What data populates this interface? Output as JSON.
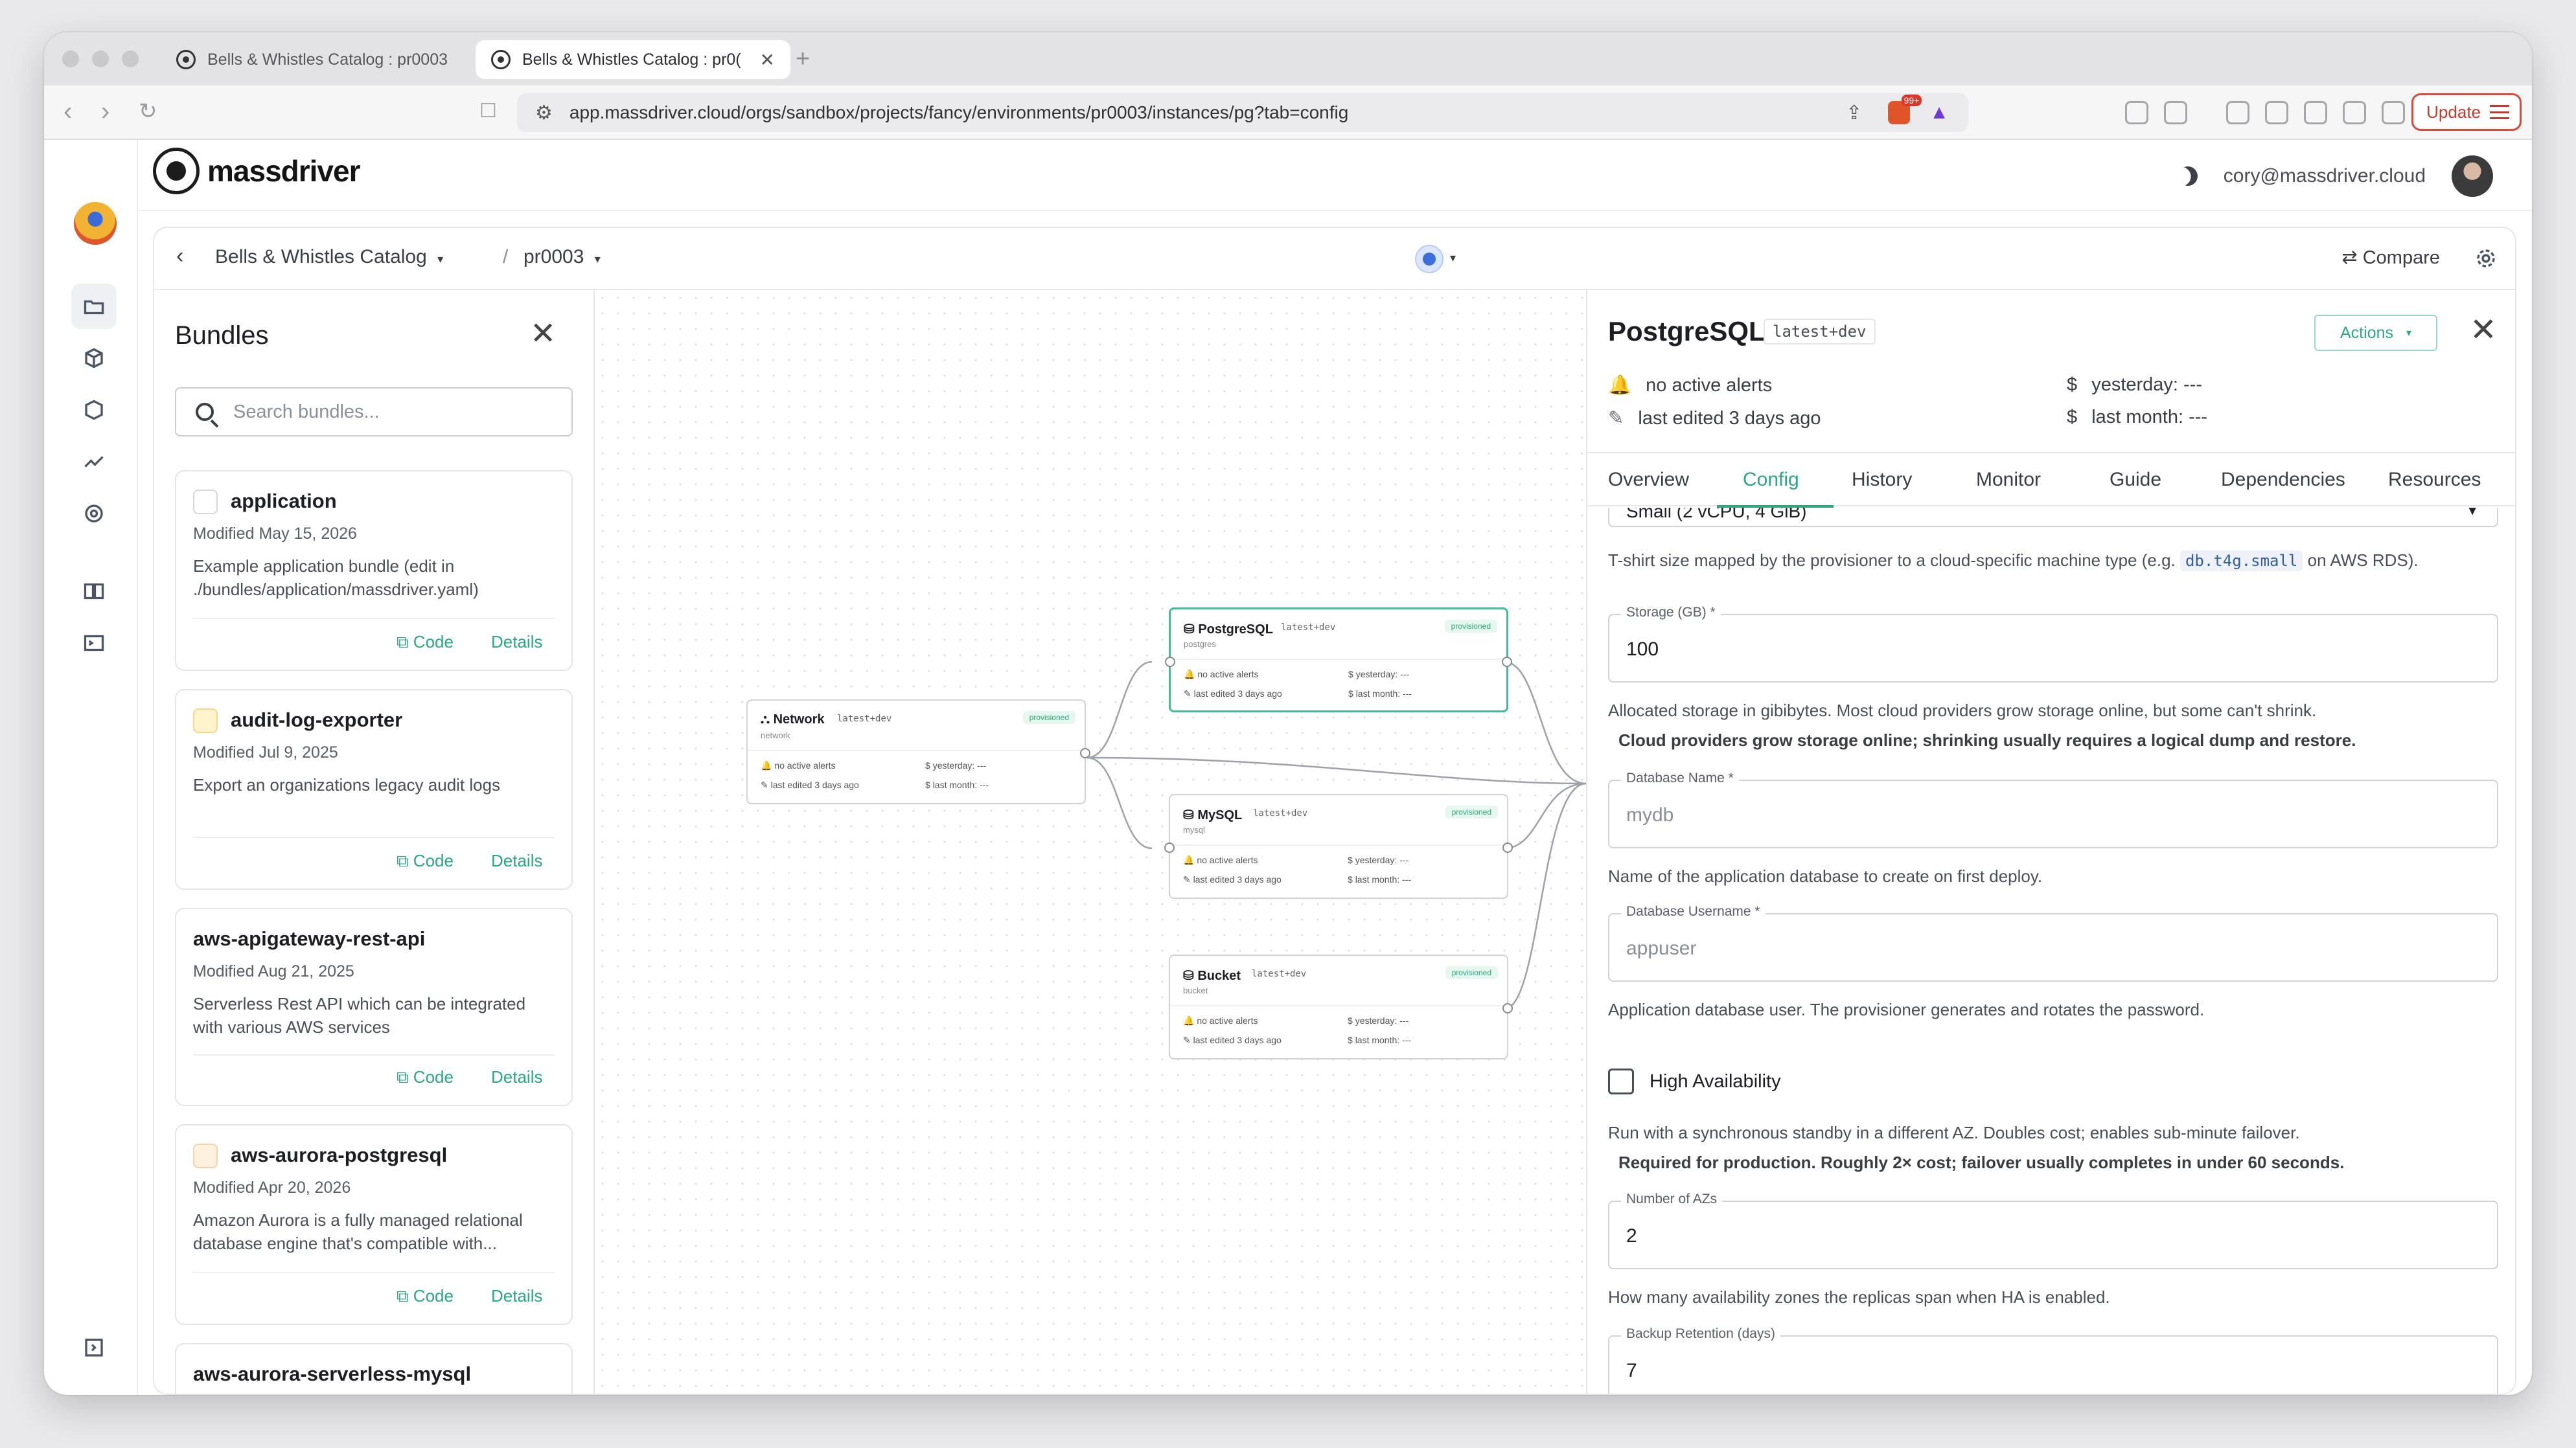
{
  "browser": {
    "tabs": [
      {
        "title": "Bells & Whistles Catalog : pr0003"
      },
      {
        "title": "Bells & Whistles Catalog : pr0("
      }
    ],
    "new_tab": "+",
    "url": "app.massdriver.cloud/orgs/sandbox/projects/fancy/environments/pr0003/instances/pg?tab=config",
    "update_label": "Update",
    "badge_count": "99+"
  },
  "app": {
    "logo_text": "massdriver",
    "user_email": "cory@massdriver.cloud"
  },
  "breadcrumb": {
    "project": "Bells & Whistles Catalog",
    "separator": "/",
    "environment": "pr0003",
    "compare_label": "Compare"
  },
  "bundles_panel": {
    "title": "Bundles",
    "search_placeholder": "Search bundles...",
    "code_label": "Code",
    "details_label": "Details",
    "items": [
      {
        "name": "application",
        "modified": "Modified May 15, 2026",
        "description": "Example application bundle (edit in ./bundles/application/massdriver.yaml)"
      },
      {
        "name": "audit-log-exporter",
        "modified": "Modified Jul 9, 2025",
        "description": "Export an organizations legacy audit logs"
      },
      {
        "name": "aws-apigateway-rest-api",
        "modified": "Modified Aug 21, 2025",
        "description": "Serverless Rest API which can be integrated with various AWS services"
      },
      {
        "name": "aws-aurora-postgresql",
        "modified": "Modified Apr 20, 2026",
        "description": "Amazon Aurora is a fully managed relational database engine that's compatible with..."
      },
      {
        "name": "aws-aurora-serverless-mysql",
        "modified": "",
        "description": ""
      }
    ]
  },
  "canvas": {
    "nodes": [
      {
        "title": "Network",
        "tag": "latest+dev",
        "type": "network",
        "status": "provisioned",
        "alerts": "no active alerts",
        "edited": "last edited 3 days ago",
        "cost_day": "yesterday: ---",
        "cost_month": "last month: ---"
      },
      {
        "title": "PostgreSQL",
        "tag": "latest+dev",
        "type": "postgres",
        "status": "provisioned",
        "alerts": "no active alerts",
        "edited": "last edited 3 days ago",
        "cost_day": "yesterday: ---",
        "cost_month": "last month: ---"
      },
      {
        "title": "MySQL",
        "tag": "latest+dev",
        "type": "mysql",
        "status": "provisioned",
        "alerts": "no active alerts",
        "edited": "last edited 3 days ago",
        "cost_day": "yesterday: ---",
        "cost_month": "last month: ---"
      },
      {
        "title": "Bucket",
        "tag": "latest+dev",
        "type": "bucket",
        "status": "provisioned",
        "alerts": "no active alerts",
        "edited": "last edited 3 days ago",
        "cost_day": "yesterday: ---",
        "cost_month": "last month: ---"
      }
    ]
  },
  "detail": {
    "title": "PostgreSQL",
    "version_tag": "latest+dev",
    "actions_label": "Actions",
    "alerts": "no active alerts",
    "last_edited": "last edited 3 days ago",
    "cost_yesterday": "yesterday: ---",
    "cost_last_month": "last month: ---",
    "dollar": "$",
    "tabs": [
      "Overview",
      "Config",
      "History",
      "Monitor",
      "Guide",
      "Dependencies",
      "Resources"
    ],
    "active_tab": "Config",
    "form": {
      "size_value": "Small (2 vCPU, 4 GiB)",
      "size_help_before": "T-shirt size mapped by the provisioner to a cloud-specific machine type (e.g.",
      "size_help_code": "db.t4g.small",
      "size_help_after": "on AWS RDS).",
      "storage_label": "Storage (GB) *",
      "storage_value": "100",
      "storage_help": "Allocated storage in gibibytes. Most cloud providers grow storage online, but some can't shrink.",
      "storage_help_bold": "Cloud providers grow storage online; shrinking usually requires a logical dump and restore.",
      "dbname_label": "Database Name *",
      "dbname_placeholder": "mydb",
      "dbname_help": "Name of the application database to create on first deploy.",
      "dbuser_label": "Database Username *",
      "dbuser_placeholder": "appuser",
      "dbuser_help": "Application database user. The provisioner generates and rotates the password.",
      "ha_label": "High Availability",
      "ha_checked": false,
      "ha_help": "Run with a synchronous standby in a different AZ. Doubles cost; enables sub-minute failover.",
      "ha_help_bold": "Required for production. Roughly 2× cost; failover usually completes in under 60 seconds.",
      "azs_label": "Number of AZs",
      "azs_value": "2",
      "azs_help": "How many availability zones the replicas span when HA is enabled.",
      "backup_label": "Backup Retention (days)",
      "backup_value": "7"
    }
  },
  "colors": {
    "accent": "#2aa87e",
    "update_red": "#c23a2c"
  }
}
